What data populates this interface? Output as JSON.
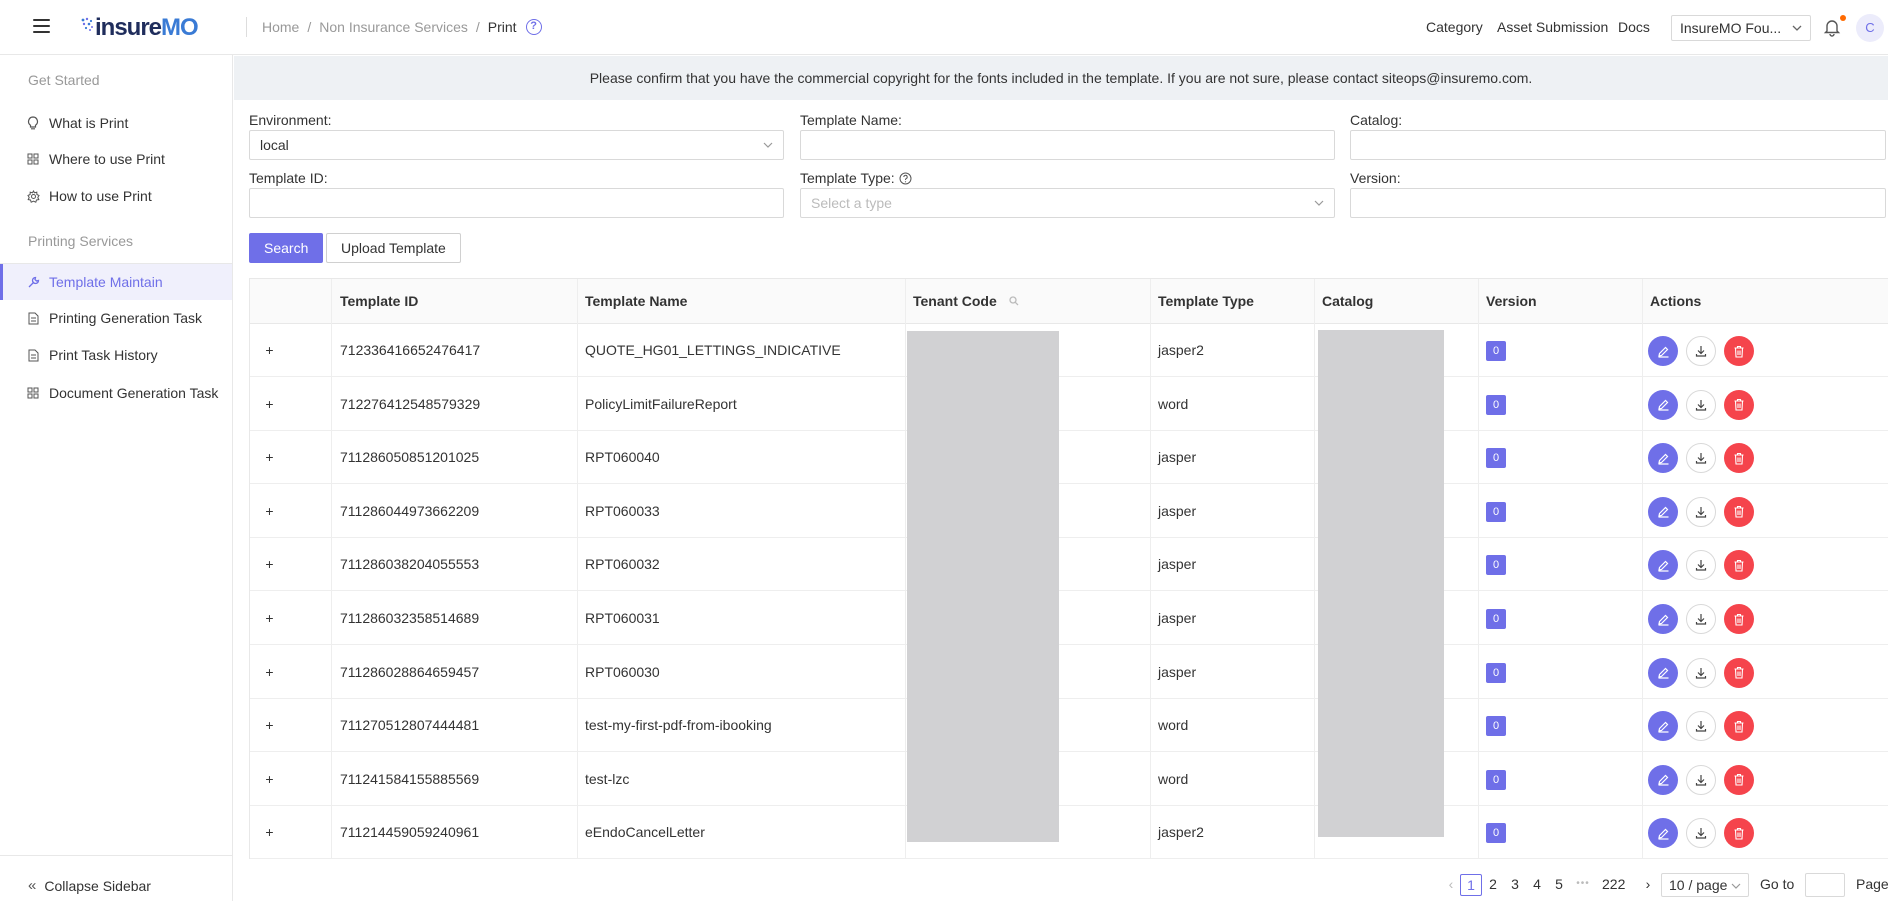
{
  "header": {
    "breadcrumb": [
      "Home",
      "Non Insurance Services",
      "Print"
    ],
    "breadcrumb_sep": "/",
    "help_icon": "?",
    "nav": [
      "Category",
      "Asset Submission",
      "Docs"
    ],
    "env_select_value": "InsureMO Fou...",
    "avatar_letter": "C",
    "logo_prefix": "insure",
    "logo_suffix": "MO"
  },
  "sidebar": {
    "group1": "Get Started",
    "items1": [
      {
        "label": "What is Print",
        "icon": "lightbulb-icon"
      },
      {
        "label": "Where to use Print",
        "icon": "grid-icon"
      },
      {
        "label": "How to use Print",
        "icon": "gear-icon"
      }
    ],
    "group2": "Printing Services",
    "items2": [
      {
        "label": "Template Maintain",
        "icon": "wrench-icon",
        "active": true
      },
      {
        "label": "Printing Generation Task",
        "icon": "document-icon"
      },
      {
        "label": "Print Task History",
        "icon": "document-icon"
      },
      {
        "label": "Document Generation Task",
        "icon": "grid-icon"
      }
    ],
    "collapse_label": "Collapse Sidebar"
  },
  "banner": "Please confirm that you have the commercial copyright for the fonts included in the template. If you are not sure, please contact siteops@insuremo.com.",
  "form": {
    "environment_label": "Environment:",
    "environment_value": "local",
    "template_name_label": "Template Name:",
    "template_name_value": "",
    "catalog_label": "Catalog:",
    "catalog_value": "",
    "template_id_label": "Template ID:",
    "template_id_value": "",
    "template_type_label": "Template Type:",
    "template_type_placeholder": "Select a type",
    "version_label": "Version:",
    "version_value": "",
    "search_button": "Search",
    "upload_button": "Upload Template"
  },
  "table": {
    "columns": [
      "Template ID",
      "Template Name",
      "Tenant Code",
      "Template Type",
      "Catalog",
      "Version",
      "Actions"
    ],
    "rows": [
      {
        "id": "712336416652476417",
        "name": "QUOTE_HG01_LETTINGS_INDICATIVE",
        "type": "jasper2",
        "version": "0"
      },
      {
        "id": "712276412548579329",
        "name": "PolicyLimitFailureReport",
        "type": "word",
        "version": "0"
      },
      {
        "id": "711286050851201025",
        "name": "RPT060040",
        "type": "jasper",
        "version": "0"
      },
      {
        "id": "711286044973662209",
        "name": "RPT060033",
        "type": "jasper",
        "version": "0"
      },
      {
        "id": "711286038204055553",
        "name": "RPT060032",
        "type": "jasper",
        "version": "0"
      },
      {
        "id": "711286032358514689",
        "name": "RPT060031",
        "type": "jasper",
        "version": "0"
      },
      {
        "id": "711286028864659457",
        "name": "RPT060030",
        "type": "jasper",
        "version": "0"
      },
      {
        "id": "711270512807444481",
        "name": "test-my-first-pdf-from-ibooking",
        "type": "word",
        "version": "0"
      },
      {
        "id": "711241584155885569",
        "name": "test-lzc",
        "type": "word",
        "version": "0"
      },
      {
        "id": "711214459059240961",
        "name": "eEndoCancelLetter",
        "type": "jasper2",
        "version": "0"
      }
    ],
    "expand_symbol": "+"
  },
  "pagination": {
    "pages": [
      "1",
      "2",
      "3",
      "4",
      "5"
    ],
    "ellipsis": "•••",
    "last_page": "222",
    "page_size": "10 / page",
    "goto_label": "Go to",
    "page_label": "Page",
    "current_page": "1"
  },
  "colors": {
    "accent": "#6f6fe8",
    "danger": "#f5444c",
    "banner_bg": "#eef1f4"
  }
}
